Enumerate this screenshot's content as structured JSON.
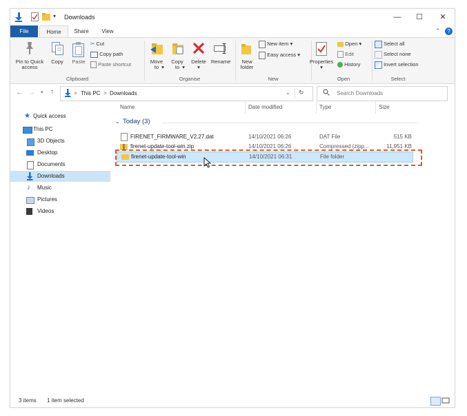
{
  "window": {
    "title": "Downloads",
    "controls": {
      "minimize": "—",
      "maximize": "☐",
      "close": "✕"
    }
  },
  "tabs": [
    {
      "label": "File"
    },
    {
      "label": "Home"
    },
    {
      "label": "Share"
    },
    {
      "label": "View"
    }
  ],
  "ribbon": {
    "clipboard": {
      "name": "Clipboard",
      "pin_line1": "Pin to Quick",
      "pin_line2": "access",
      "copy": "Copy",
      "paste": "Paste",
      "cut": "Cut",
      "copy_path": "Copy path",
      "paste_shortcut": "Paste shortcut"
    },
    "organise": {
      "name": "Organise",
      "move_line1": "Move",
      "move_line2": "to",
      "copy_line1": "Copy",
      "copy_line2": "to",
      "delete": "Delete",
      "rename": "Rename"
    },
    "new": {
      "name": "New",
      "folder_line1": "New",
      "folder_line2": "folder",
      "new_item": "New item",
      "easy_access": "Easy access"
    },
    "open": {
      "name": "Open",
      "properties": "Properties",
      "open": "Open",
      "edit": "Edit",
      "history": "History"
    },
    "select": {
      "name": "Select",
      "select_all": "Select all",
      "select_none": "Select none",
      "invert": "Invert selection"
    }
  },
  "address": {
    "crumb1": "This PC",
    "sep": ">",
    "crumb2": "Downloads",
    "search_placeholder": "Search Downloads"
  },
  "nav": {
    "quick_access": "Quick access",
    "this_pc": "This PC",
    "items": [
      "3D Objects",
      "Desktop",
      "Documents",
      "Downloads",
      "Music",
      "Pictures",
      "Videos"
    ]
  },
  "columns": {
    "name": "Name",
    "date": "Date modified",
    "type": "Type",
    "size": "Size"
  },
  "group": {
    "label": "Today (3)"
  },
  "files": [
    {
      "name": "FIRENET_FIRMWARE_V2.27.dat",
      "date": "14/10/2021 06:26",
      "type": "DAT File",
      "size": "515 KB"
    },
    {
      "name": "firenet-update-tool-win.zip",
      "date": "14/10/2021 06:26",
      "type": "Compressed (zipp...",
      "size": "11,951 KB"
    },
    {
      "name": "firenet-update-tool-win",
      "date": "14/10/2021 06:31",
      "type": "File folder",
      "size": ""
    }
  ],
  "status": {
    "items": "3 items",
    "selected": "1 item selected"
  },
  "colors": {
    "accent": "#1c5fa8",
    "selection": "#cce8ff",
    "highlight": "#e2571e"
  }
}
